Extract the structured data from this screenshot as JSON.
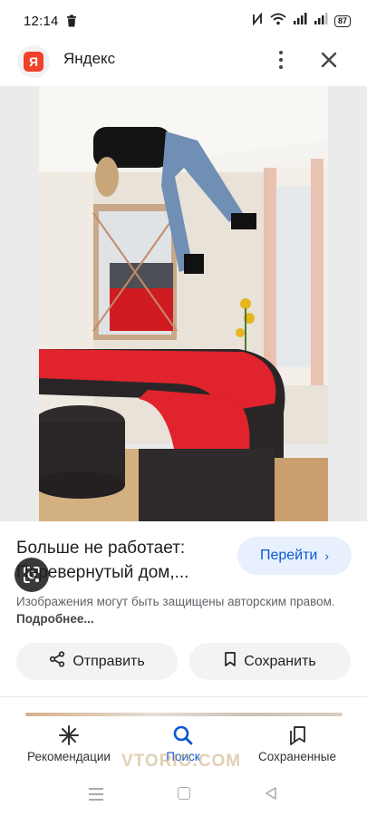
{
  "status_bar": {
    "time": "12:14",
    "battery": "87",
    "icons": [
      "trash-icon",
      "nfc-icon",
      "wifi-icon",
      "signal-icon",
      "signal-icon",
      "battery-icon"
    ]
  },
  "header": {
    "logo_letter": "Я",
    "title": "Яндекс",
    "menu_icon": "more-vert-icon",
    "close_icon": "close-icon"
  },
  "image": {
    "lens_icon": "lens-icon"
  },
  "result": {
    "title": "Больше не работает: Перевернутый дом,...",
    "visit_label": "Перейти",
    "visit_chevron": "›",
    "copyright_text": "Изображения могут быть защищены авторским правом.",
    "copyright_more": "Подробнее..."
  },
  "actions": {
    "share_label": "Отправить",
    "save_label": "Сохранить"
  },
  "bottom_nav": {
    "items": [
      {
        "label": "Рекомендации",
        "icon": "sparkle-icon",
        "active": false
      },
      {
        "label": "Поиск",
        "icon": "search-icon",
        "active": true
      },
      {
        "label": "Сохраненные",
        "icon": "collections-icon",
        "active": false
      }
    ]
  },
  "watermark": "VTORIO.COM",
  "colors": {
    "accent": "#0b57d0",
    "accent_bg": "#e8f0fe",
    "button_bg": "#f1f3f4",
    "yandex_red": "#f0412a",
    "sofa_red": "#e0232c"
  }
}
